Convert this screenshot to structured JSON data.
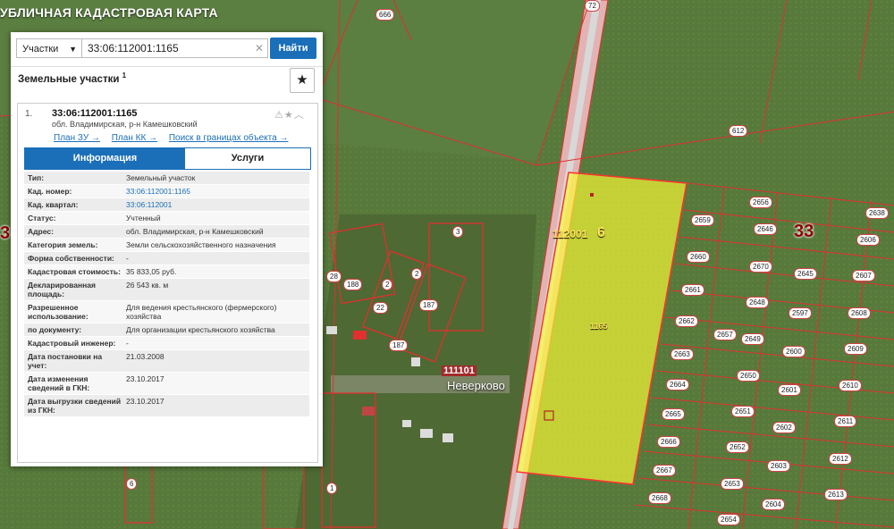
{
  "app": {
    "title": "УБЛИЧНАЯ КАДАСТРОВАЯ КАРТА"
  },
  "search": {
    "type_label": "Участки",
    "query": "33:06:112001:1165",
    "button_label": "Найти"
  },
  "results": {
    "title": "Земельные участки",
    "count": "1",
    "item": {
      "index": "1.",
      "cad_number": "33:06:112001:1165",
      "address": "обл. Владимирская, р-н Камешковский",
      "links": [
        "План ЗУ →",
        "План КК →",
        "Поиск в границах объекта →"
      ]
    },
    "tabs": [
      "Информация",
      "Услуги"
    ],
    "info_rows": [
      {
        "k": "Тип:",
        "v": "Земельный участок",
        "link": false
      },
      {
        "k": "Кад. номер:",
        "v": "33:06:112001:1165",
        "link": true
      },
      {
        "k": "Кад. квартал:",
        "v": "33:06:112001",
        "link": true
      },
      {
        "k": "Статус:",
        "v": "Учтенный",
        "link": false
      },
      {
        "k": "Адрес:",
        "v": "обл. Владимирская, р-н Камешковский",
        "link": false
      },
      {
        "k": "Категория земель:",
        "v": "Земли сельскохозяйственного назначения",
        "link": false
      },
      {
        "k": "Форма собственности:",
        "v": "-",
        "link": false
      },
      {
        "k": "Кадастровая стоимость:",
        "v": "35 833,05 руб.",
        "link": false
      },
      {
        "k": "Декларированная площадь:",
        "v": "26 543 кв. м",
        "link": false
      },
      {
        "k": "Разрешенное использование:",
        "v": "Для ведения крестьянского (фермерского) хозяйства",
        "link": false
      },
      {
        "k": "по документу:",
        "v": "Для организации крестьянского хозяйства",
        "link": false
      },
      {
        "k": "Кадастровый инженер:",
        "v": "-",
        "link": false
      },
      {
        "k": "Дата постановки на учет:",
        "v": "21.03.2008",
        "link": false
      },
      {
        "k": "Дата изменения сведений в ГКН:",
        "v": "23.10.2017",
        "link": false
      },
      {
        "k": "Дата выгрузки сведений из ГКН:",
        "v": "23.10.2017",
        "link": false
      }
    ]
  },
  "map": {
    "road_label": "72",
    "quarter_code": "112001",
    "quarter_sub": "6",
    "region_label": "33",
    "region_label_left": "3",
    "selected_parcel_label": "1165",
    "village_code": "111101",
    "village_name": "Неверково",
    "parcel_labels": [
      "666",
      "612",
      "2656",
      "2638",
      "2659",
      "2646",
      "2606",
      "2660",
      "2670",
      "2645",
      "2607",
      "2661",
      "2648",
      "2597",
      "2608",
      "2662",
      "2657",
      "2649",
      "2600",
      "2609",
      "2663",
      "2650",
      "2610",
      "2664",
      "2601",
      "2665",
      "2651",
      "2611",
      "2602",
      "2666",
      "2652",
      "2612",
      "2603",
      "2667",
      "2653",
      "2613",
      "2604",
      "2668",
      "2654",
      "3",
      "2",
      "2",
      "28",
      "188",
      "22",
      "187",
      "187",
      "6",
      "1"
    ],
    "colors": {
      "parcel_border": "#e03030",
      "selected_fill": "#ffff33",
      "road": "#d8d8d8"
    }
  }
}
